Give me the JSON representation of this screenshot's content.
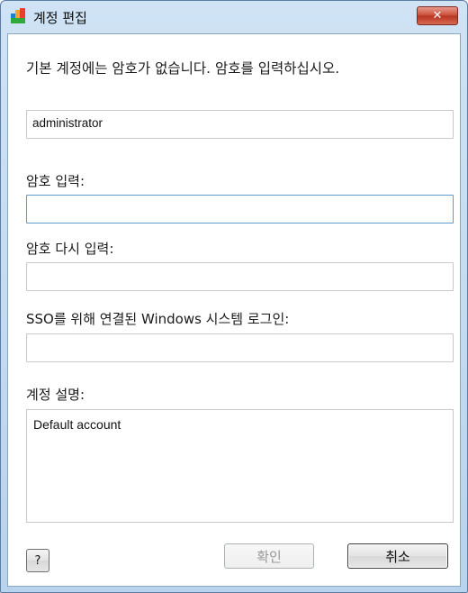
{
  "window": {
    "title": "계정 편집",
    "close_label": "✕"
  },
  "dialog": {
    "intro": "기본 계정에는 암호가 없습니다. 암호를 입력하십시오.",
    "username_value": "administrator",
    "password_label": "암호 입력:",
    "password_value": "",
    "confirm_label": "암호 다시 입력:",
    "confirm_value": "",
    "sso_label": "SSO를 위해 연결된 Windows 시스템 로그인:",
    "sso_value": "",
    "description_label": "계정 설명:",
    "description_value": "Default account"
  },
  "buttons": {
    "help": "?",
    "ok": "확인",
    "cancel": "취소"
  },
  "colors": {
    "titlebar": "#c4dbf1",
    "close": "#c94a36",
    "focus_border": "#5f9bd1"
  },
  "icons": {
    "app": "avg-logo-icon"
  }
}
